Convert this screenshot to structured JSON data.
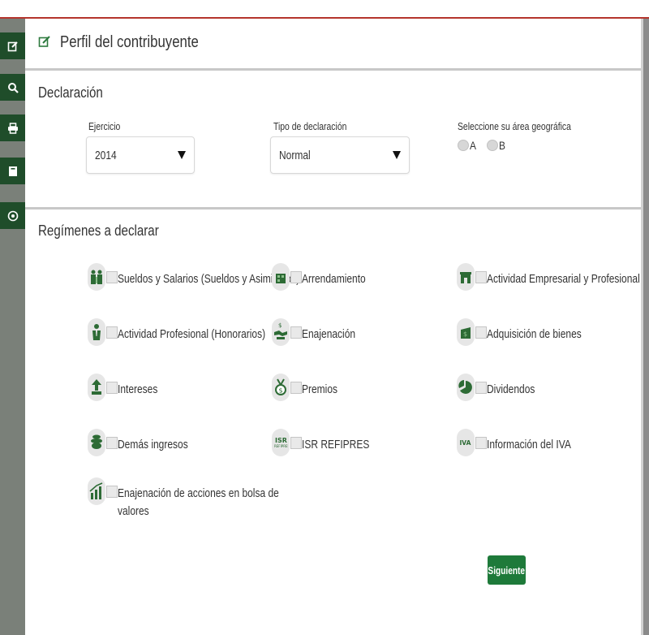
{
  "header": {
    "title": "Perfil del contribuyente"
  },
  "sidebar": {
    "items": [
      {
        "name": "edit-icon"
      },
      {
        "name": "search-icon"
      },
      {
        "name": "print-icon"
      },
      {
        "name": "archive-icon"
      },
      {
        "name": "info-icon"
      }
    ],
    "color": "#1f4d2a"
  },
  "declaracion": {
    "title": "Declaración",
    "ejercicio": {
      "label": "Ejercicio",
      "value": "2014"
    },
    "tipo": {
      "label": "Tipo de declaración",
      "value": "Normal"
    },
    "area": {
      "label": "Seleccione su área geográfica",
      "options": [
        "A",
        "B"
      ]
    }
  },
  "regimenes": {
    "title": "Regímenes a declarar",
    "items": [
      {
        "label": "Sueldos y Salarios (Sueldos y Asimilados)",
        "icon": "workers-icon"
      },
      {
        "label": "Arrendamiento",
        "icon": "building-icon"
      },
      {
        "label": "Actividad Empresarial y Profesional",
        "icon": "store-icon"
      },
      {
        "label": "Actividad Profesional (Honorarios)",
        "icon": "professional-icon"
      },
      {
        "label": "Enajenación",
        "icon": "handshake-icon"
      },
      {
        "label": "Adquisición de bienes",
        "icon": "money-bag-icon"
      },
      {
        "label": "Intereses",
        "icon": "growth-arrow-icon"
      },
      {
        "label": "Premios",
        "icon": "medal-icon"
      },
      {
        "label": "Dividendos",
        "icon": "pie-chart-icon"
      },
      {
        "label": "Demás ingresos",
        "icon": "coins-icon"
      },
      {
        "label": "ISR REFIPRES",
        "icon": "isr-refipres-icon"
      },
      {
        "label": "Información del IVA",
        "icon": "iva-icon"
      },
      {
        "label1": "Enajenación de acciones en bolsa de",
        "label2": "valores",
        "icon": "stock-chart-icon"
      }
    ]
  },
  "buttons": {
    "next": "Siguiente"
  },
  "colors": {
    "accent": "#1e7a3a",
    "topline": "#b5352d"
  }
}
